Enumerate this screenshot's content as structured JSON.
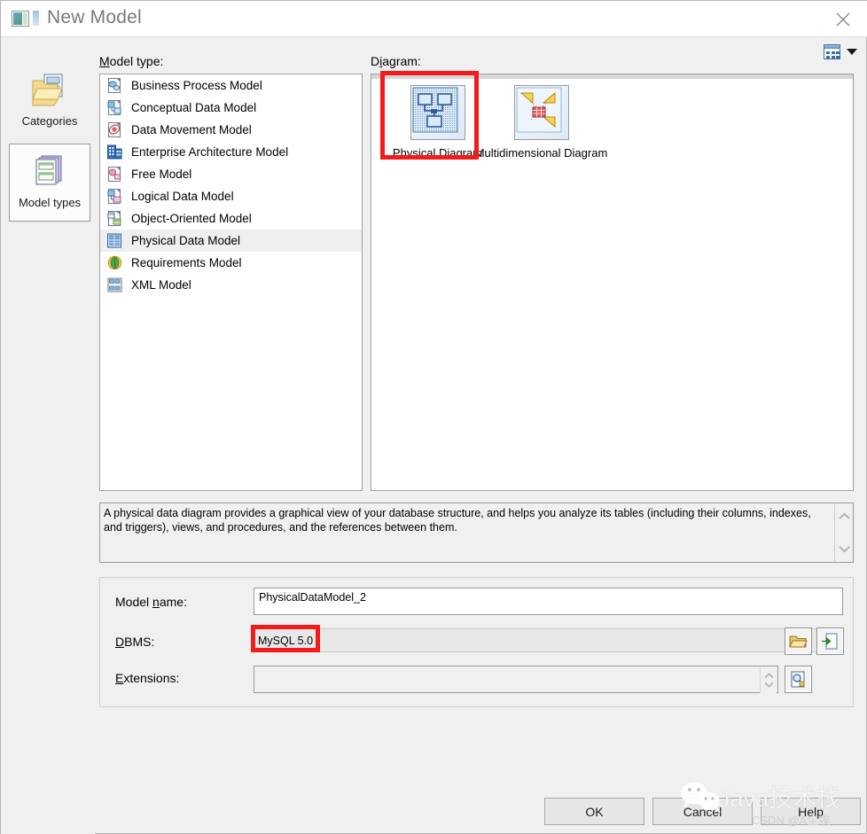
{
  "window": {
    "title": "New Model",
    "icon": "new-model-icon",
    "close_label": "✕"
  },
  "rail": {
    "items": [
      {
        "label": "Categories",
        "icon": "categories-folder-icon",
        "selected": false
      },
      {
        "label": "Model types",
        "icon": "model-types-stack-icon",
        "selected": true
      }
    ]
  },
  "labels": {
    "model_type": "Model type:",
    "model_type_mnemonic": "M",
    "diagram": "Diagram:",
    "diagram_mnemonic": "i"
  },
  "view_toggle": {
    "icon": "view-mode-icon",
    "caret_icon": "caret-down-icon"
  },
  "model_types": [
    {
      "label": "Business Process Model",
      "icon": "business-process-model-icon",
      "selected": false
    },
    {
      "label": "Conceptual Data Model",
      "icon": "conceptual-data-model-icon",
      "selected": false
    },
    {
      "label": "Data Movement Model",
      "icon": "data-movement-model-icon",
      "selected": false
    },
    {
      "label": "Enterprise Architecture Model",
      "icon": "enterprise-architecture-model-icon",
      "selected": false
    },
    {
      "label": "Free Model",
      "icon": "free-model-icon",
      "selected": false
    },
    {
      "label": "Logical Data Model",
      "icon": "logical-data-model-icon",
      "selected": false
    },
    {
      "label": "Object-Oriented Model",
      "icon": "object-oriented-model-icon",
      "selected": false
    },
    {
      "label": "Physical Data Model",
      "icon": "physical-data-model-icon",
      "selected": true
    },
    {
      "label": "Requirements Model",
      "icon": "requirements-model-icon",
      "selected": false
    },
    {
      "label": "XML Model",
      "icon": "xml-model-icon",
      "selected": false
    }
  ],
  "diagrams": [
    {
      "label": "Physical Diagram",
      "icon": "physical-diagram-thumb",
      "selected": true
    },
    {
      "label": "Multidimensional Diagram",
      "icon": "multidimensional-diagram-thumb",
      "selected": false
    }
  ],
  "description": {
    "text": "A physical data diagram provides a graphical view of your database structure, and helps you analyze its tables (including their columns, indexes, and triggers), views, and procedures, and the references between them.",
    "scroll_up_icon": "chevron-up-icon",
    "scroll_down_icon": "chevron-down-icon"
  },
  "form": {
    "model_name_label": "Model name:",
    "model_name_mnemonic": "n",
    "model_name_value": "PhysicalDataModel_2",
    "dbms_label": "DBMS:",
    "dbms_mnemonic": "D",
    "dbms_value": "MySQL 5.0",
    "extensions_label": "Extensions:",
    "extensions_mnemonic": "E",
    "extensions_value": "",
    "dbms_browse_icon": "folder-open-icon",
    "dbms_share_icon": "file-arrow-icon",
    "extensions_preview_icon": "document-preview-icon"
  },
  "buttons": {
    "ok": "OK",
    "cancel": "Cancel",
    "help": "Help"
  },
  "annotations": {
    "highlight_color": "#f41b1b",
    "boxes": [
      {
        "target": "physical-diagram"
      },
      {
        "target": "dbms-value"
      }
    ]
  },
  "watermark": {
    "text": "Java技术栈",
    "subtext": "CSDN @A尘埃",
    "logo_icon": "wechat-logo-icon"
  }
}
